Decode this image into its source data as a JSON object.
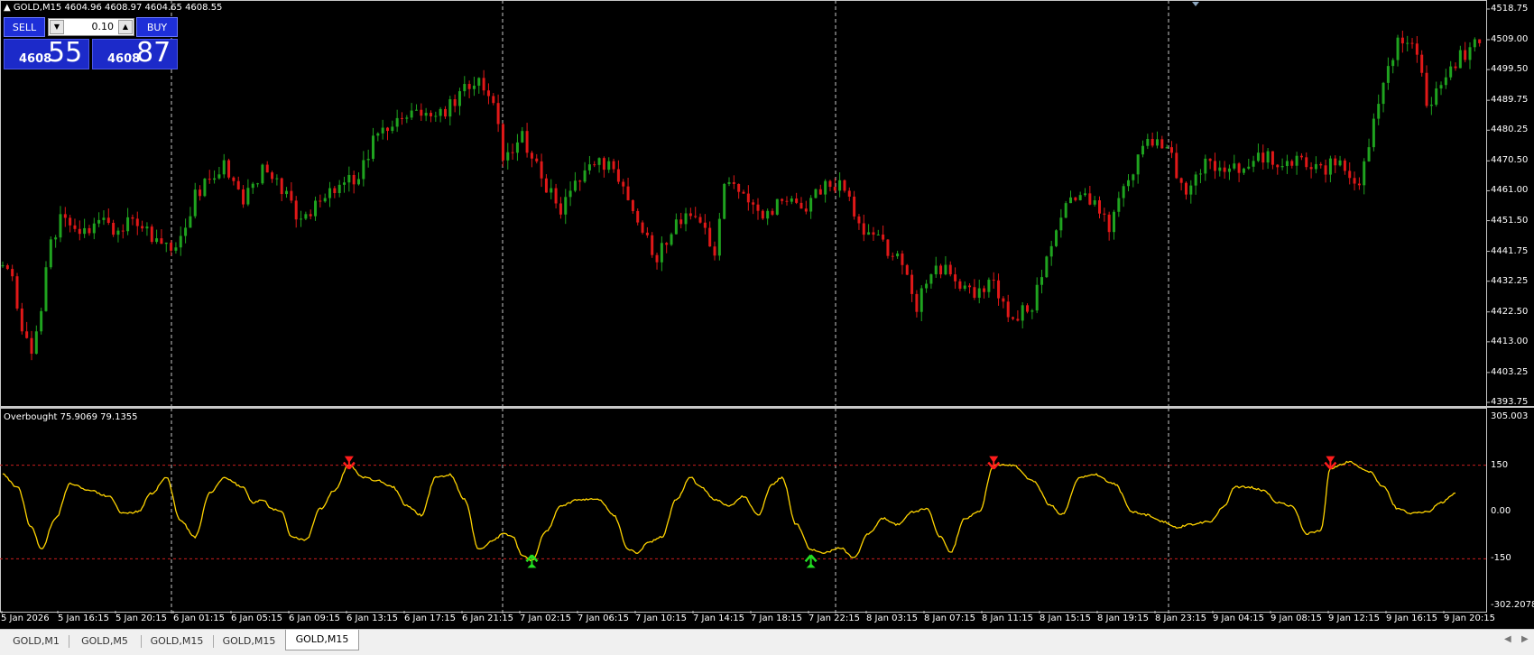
{
  "window": {
    "symbol_info": "GOLD,M15  4604.96 4608.97 4604.65 4608.55"
  },
  "trade_panel": {
    "sell_label": "SELL",
    "buy_label": "BUY",
    "lot": "0.10",
    "sell_price_prefix": "4608",
    "sell_price_big": "55",
    "buy_price_prefix": "4608",
    "buy_price_big": "87"
  },
  "price_axis": [
    "4518.75",
    "4509.00",
    "4499.50",
    "4489.75",
    "4480.25",
    "4470.50",
    "4461.00",
    "4451.50",
    "4441.75",
    "4432.25",
    "4422.50",
    "4413.00",
    "4403.25",
    "4393.75"
  ],
  "indicator": {
    "title": "Overbought 75.9069 79.1355",
    "axis": [
      "305.003",
      "150",
      "0.00",
      "-150",
      "-302.2078"
    ]
  },
  "time_axis": [
    "5 Jan 2026",
    "5 Jan 16:15",
    "5 Jan 20:15",
    "6 Jan 01:15",
    "6 Jan 05:15",
    "6 Jan 09:15",
    "6 Jan 13:15",
    "6 Jan 17:15",
    "6 Jan 21:15",
    "7 Jan 02:15",
    "7 Jan 06:15",
    "7 Jan 10:15",
    "7 Jan 14:15",
    "7 Jan 18:15",
    "7 Jan 22:15",
    "8 Jan 03:15",
    "8 Jan 07:15",
    "8 Jan 11:15",
    "8 Jan 15:15",
    "8 Jan 19:15",
    "8 Jan 23:15",
    "9 Jan 04:15",
    "9 Jan 08:15",
    "9 Jan 12:15",
    "9 Jan 16:15",
    "9 Jan 20:15"
  ],
  "tabs": [
    {
      "label": "GOLD,M1",
      "active": false
    },
    {
      "label": "GOLD,M5",
      "active": false
    },
    {
      "label": "GOLD,M15",
      "active": false
    },
    {
      "label": "GOLD,M15",
      "active": false
    },
    {
      "label": "GOLD,M15",
      "active": true
    }
  ],
  "colors": {
    "bull": "#1fa31f",
    "bear": "#e01818",
    "indicator_line": "#ffd400",
    "level_line": "#c81e1e",
    "sell_arrow": "#ff1c1c",
    "buy_arrow": "#22e022",
    "background": "#000000"
  },
  "chart_data": {
    "type": "candlestick",
    "symbol": "GOLD",
    "timeframe": "M15",
    "ylim": [
      4393.75,
      4518.75
    ],
    "close_path": [
      [
        0,
        4437
      ],
      [
        2,
        4432
      ],
      [
        4,
        4418
      ],
      [
        6,
        4410
      ],
      [
        8,
        4425
      ],
      [
        10,
        4445
      ],
      [
        12,
        4452
      ],
      [
        16,
        4447
      ],
      [
        20,
        4451
      ],
      [
        24,
        4449
      ],
      [
        28,
        4452
      ],
      [
        32,
        4445
      ],
      [
        36,
        4441
      ],
      [
        40,
        4460
      ],
      [
        44,
        4467
      ],
      [
        46,
        4470
      ],
      [
        50,
        4458
      ],
      [
        54,
        4467
      ],
      [
        58,
        4461
      ],
      [
        62,
        4451
      ],
      [
        66,
        4458
      ],
      [
        70,
        4462
      ],
      [
        74,
        4466
      ],
      [
        78,
        4480
      ],
      [
        82,
        4485
      ],
      [
        86,
        4488
      ],
      [
        90,
        4483
      ],
      [
        94,
        4490
      ],
      [
        98,
        4496
      ],
      [
        102,
        4490
      ],
      [
        104,
        4473
      ],
      [
        108,
        4478
      ],
      [
        112,
        4465
      ],
      [
        116,
        4455
      ],
      [
        120,
        4465
      ],
      [
        124,
        4470
      ],
      [
        128,
        4466
      ],
      [
        132,
        4452
      ],
      [
        136,
        4440
      ],
      [
        140,
        4450
      ],
      [
        144,
        4455
      ],
      [
        148,
        4440
      ],
      [
        150,
        4465
      ],
      [
        154,
        4460
      ],
      [
        158,
        4452
      ],
      [
        162,
        4458
      ],
      [
        166,
        4455
      ],
      [
        170,
        4462
      ],
      [
        174,
        4464
      ],
      [
        178,
        4450
      ],
      [
        182,
        4445
      ],
      [
        186,
        4440
      ],
      [
        190,
        4425
      ],
      [
        194,
        4438
      ],
      [
        198,
        4432
      ],
      [
        202,
        4428
      ],
      [
        206,
        4432
      ],
      [
        210,
        4420
      ],
      [
        214,
        4425
      ],
      [
        218,
        4445
      ],
      [
        222,
        4460
      ],
      [
        226,
        4458
      ],
      [
        230,
        4450
      ],
      [
        234,
        4465
      ],
      [
        238,
        4478
      ],
      [
        242,
        4475
      ],
      [
        246,
        4460
      ],
      [
        250,
        4470
      ],
      [
        254,
        4465
      ],
      [
        258,
        4470
      ],
      [
        262,
        4472
      ],
      [
        266,
        4469
      ],
      [
        270,
        4472
      ],
      [
        274,
        4468
      ],
      [
        278,
        4470
      ],
      [
        282,
        4462
      ],
      [
        286,
        4490
      ],
      [
        290,
        4510
      ],
      [
        294,
        4505
      ],
      [
        296,
        4488
      ],
      [
        300,
        4498
      ],
      [
        304,
        4505
      ],
      [
        307,
        4509
      ]
    ],
    "indicator": {
      "name": "Overbought",
      "values_shown": [
        75.9069,
        79.1355
      ],
      "levels": [
        150,
        -150
      ],
      "ylim": [
        -302.2078,
        305.003
      ],
      "series": [
        [
          0,
          120
        ],
        [
          3,
          80
        ],
        [
          6,
          -50
        ],
        [
          8,
          -120
        ],
        [
          11,
          -20
        ],
        [
          14,
          90
        ],
        [
          18,
          70
        ],
        [
          22,
          50
        ],
        [
          25,
          -5
        ],
        [
          28,
          0
        ],
        [
          31,
          60
        ],
        [
          34,
          110
        ],
        [
          37,
          -30
        ],
        [
          40,
          -80
        ],
        [
          43,
          60
        ],
        [
          46,
          110
        ],
        [
          50,
          80
        ],
        [
          52,
          30
        ],
        [
          54,
          40
        ],
        [
          56,
          10
        ],
        [
          58,
          0
        ],
        [
          60,
          -80
        ],
        [
          63,
          -90
        ],
        [
          66,
          10
        ],
        [
          69,
          70
        ],
        [
          72,
          150
        ],
        [
          75,
          110
        ],
        [
          78,
          100
        ],
        [
          81,
          80
        ],
        [
          84,
          20
        ],
        [
          87,
          -10
        ],
        [
          90,
          110
        ],
        [
          93,
          120
        ],
        [
          96,
          40
        ],
        [
          99,
          -120
        ],
        [
          102,
          -90
        ],
        [
          104,
          -70
        ],
        [
          106,
          -80
        ],
        [
          108,
          -140
        ],
        [
          110,
          -155
        ],
        [
          113,
          -60
        ],
        [
          116,
          20
        ],
        [
          120,
          40
        ],
        [
          124,
          40
        ],
        [
          127,
          -10
        ],
        [
          130,
          -120
        ],
        [
          132,
          -130
        ],
        [
          134,
          -100
        ],
        [
          137,
          -80
        ],
        [
          140,
          40
        ],
        [
          143,
          110
        ],
        [
          145,
          80
        ],
        [
          148,
          40
        ],
        [
          151,
          20
        ],
        [
          154,
          50
        ],
        [
          157,
          -10
        ],
        [
          160,
          90
        ],
        [
          162,
          110
        ],
        [
          165,
          -40
        ],
        [
          168,
          -120
        ],
        [
          171,
          -130
        ],
        [
          174,
          -115
        ],
        [
          177,
          -145
        ],
        [
          180,
          -70
        ],
        [
          183,
          -20
        ],
        [
          186,
          -40
        ],
        [
          189,
          0
        ],
        [
          192,
          10
        ],
        [
          195,
          -80
        ],
        [
          197,
          -130
        ],
        [
          200,
          -20
        ],
        [
          203,
          0
        ],
        [
          206,
          150
        ],
        [
          210,
          150
        ],
        [
          214,
          100
        ],
        [
          218,
          20
        ],
        [
          220,
          -10
        ],
        [
          224,
          110
        ],
        [
          227,
          120
        ],
        [
          231,
          90
        ],
        [
          235,
          0
        ],
        [
          238,
          -10
        ],
        [
          241,
          -30
        ],
        [
          244,
          -50
        ],
        [
          247,
          -40
        ],
        [
          251,
          -30
        ],
        [
          254,
          20
        ],
        [
          256,
          80
        ],
        [
          259,
          80
        ],
        [
          262,
          70
        ],
        [
          265,
          30
        ],
        [
          268,
          20
        ],
        [
          271,
          -70
        ],
        [
          274,
          -60
        ],
        [
          276,
          140
        ],
        [
          280,
          160
        ],
        [
          284,
          130
        ],
        [
          287,
          80
        ],
        [
          290,
          10
        ],
        [
          293,
          -5
        ],
        [
          296,
          0
        ],
        [
          299,
          30
        ],
        [
          302,
          60
        ]
      ],
      "sell_signals": [
        72,
        206,
        276
      ],
      "buy_signals": [
        110,
        168
      ]
    }
  }
}
